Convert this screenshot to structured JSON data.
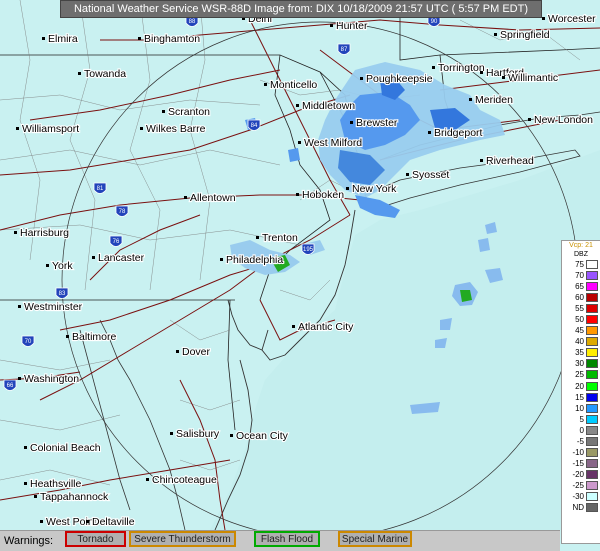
{
  "title": "National Weather Service WSR-88D Image from: DIX 10/18/2009 21:57 UTC ( 5:57 PM EDT)",
  "cities": [
    {
      "name": "Delhi"
    },
    {
      "name": "Hunter"
    },
    {
      "name": "Worcester"
    },
    {
      "name": "Elmira"
    },
    {
      "name": "Binghamton"
    },
    {
      "name": "Springfield"
    },
    {
      "name": "Towanda"
    },
    {
      "name": "Monticello"
    },
    {
      "name": "Poughkeepsie"
    },
    {
      "name": "Torrington"
    },
    {
      "name": "Hartford"
    },
    {
      "name": "Willimantic"
    },
    {
      "name": "Middletown"
    },
    {
      "name": "Meriden"
    },
    {
      "name": "Scranton"
    },
    {
      "name": "Wilkes Barre"
    },
    {
      "name": "Williamsport"
    },
    {
      "name": "New London"
    },
    {
      "name": "Brewster"
    },
    {
      "name": "Bridgeport"
    },
    {
      "name": "West Milford"
    },
    {
      "name": "Riverhead"
    },
    {
      "name": "Syosset"
    },
    {
      "name": "New York"
    },
    {
      "name": "Allentown"
    },
    {
      "name": "Hoboken"
    },
    {
      "name": "Harrisburg"
    },
    {
      "name": "Trenton"
    },
    {
      "name": "Lancaster"
    },
    {
      "name": "Philadelphia"
    },
    {
      "name": "York"
    },
    {
      "name": "Westminster"
    },
    {
      "name": "Baltimore"
    },
    {
      "name": "Atlantic City"
    },
    {
      "name": "Dover"
    },
    {
      "name": "Washington"
    },
    {
      "name": "Salisbury"
    },
    {
      "name": "Ocean City"
    },
    {
      "name": "Colonial Beach"
    },
    {
      "name": "Chincoteague"
    },
    {
      "name": "Heathsville"
    },
    {
      "name": "Tappahannock"
    },
    {
      "name": "West Point"
    },
    {
      "name": "Deltaville"
    }
  ],
  "shields": [
    "88",
    "90",
    "87",
    "84",
    "81",
    "78",
    "76",
    "195",
    "70",
    "83",
    "66"
  ],
  "legend": {
    "header_value": "Vcp: 21",
    "unit": "DBZ",
    "levels": [
      {
        "label": "75",
        "color": "#ffffff"
      },
      {
        "label": "70",
        "color": "#9955ff"
      },
      {
        "label": "65",
        "color": "#ff00ff"
      },
      {
        "label": "60",
        "color": "#bb0000"
      },
      {
        "label": "55",
        "color": "#dd0000"
      },
      {
        "label": "50",
        "color": "#ff0000"
      },
      {
        "label": "45",
        "color": "#ff9900"
      },
      {
        "label": "40",
        "color": "#ddaa00"
      },
      {
        "label": "35",
        "color": "#ffee00"
      },
      {
        "label": "30",
        "color": "#008800"
      },
      {
        "label": "25",
        "color": "#00bb00"
      },
      {
        "label": "20",
        "color": "#00ff00"
      },
      {
        "label": "15",
        "color": "#0000ee"
      },
      {
        "label": "10",
        "color": "#2299ff"
      },
      {
        "label": "5",
        "color": "#00ccff"
      },
      {
        "label": "0",
        "color": "#888888"
      },
      {
        "label": "-5",
        "color": "#777777"
      },
      {
        "label": "-10",
        "color": "#999966"
      },
      {
        "label": "-15",
        "color": "#886688"
      },
      {
        "label": "-20",
        "color": "#663366"
      },
      {
        "label": "-25",
        "color": "#cc99cc"
      },
      {
        "label": "-30",
        "color": "#ccffff"
      },
      {
        "label": "ND",
        "color": "#666666"
      }
    ]
  },
  "warnings": {
    "label": "Warnings:",
    "items": [
      {
        "label": "Tornado",
        "color": "#cc0000"
      },
      {
        "label": "Severe Thunderstorm",
        "color": "#cc8800"
      },
      {
        "label": "Flash Flood",
        "color": "#00aa00"
      },
      {
        "label": "Special Marine",
        "color": "#cc8800"
      }
    ]
  }
}
